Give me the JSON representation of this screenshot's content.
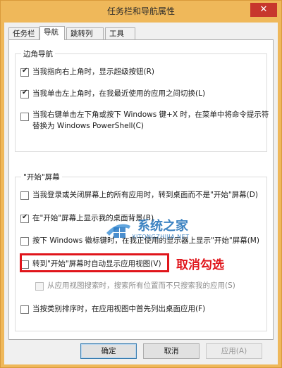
{
  "window": {
    "title": "任务栏和导航属性",
    "close_glyph": "✕"
  },
  "tabs": [
    {
      "label": "任务栏",
      "active": false
    },
    {
      "label": "导航",
      "active": true
    },
    {
      "label": "跳转列表",
      "active": false
    },
    {
      "label": "工具栏",
      "active": false
    }
  ],
  "corner_nav": {
    "heading": "边角导航",
    "options": [
      {
        "label": "当我指向右上角时，显示超级按钮(R)",
        "checked": true
      },
      {
        "label": "当我单击左上角时，在我最近使用的应用之间切换(L)",
        "checked": true
      },
      {
        "label_line1": "当我右键单击左下角或按下 Windows 键+X 时，在菜单中将命令提示符",
        "label_line2": "替换为 Windows PowerShell(C)",
        "checked": false
      }
    ]
  },
  "start_screen": {
    "heading": "\"开始\"屏幕",
    "options": [
      {
        "label": "当我登录或关闭屏幕上的所有应用时，转到桌面而不是\"开始\"屏幕(D)",
        "checked": false
      },
      {
        "label": "在\"开始\"屏幕上显示我的桌面背景(B)",
        "checked": true
      },
      {
        "label": "按下 Windows 徽标键时，在我正使用的显示器上显示\"开始\"屏幕(M)",
        "checked": false
      },
      {
        "label": "转到\"开始\"屏幕时自动显示应用视图(V)",
        "checked": false
      },
      {
        "label": "从应用视图搜索时，搜索所有位置而不只搜索我的应用(S)",
        "checked": false,
        "disabled": true
      },
      {
        "label": "当按类别排序时，在应用视图中首先列出桌面应用(F)",
        "checked": false
      }
    ]
  },
  "annotation": {
    "text": "取消勾选",
    "color": "#e0151b"
  },
  "watermark": {
    "text": "系统之家",
    "sub": "XITONGZHIJIA.NET"
  },
  "buttons": {
    "ok": "确定",
    "cancel": "取消",
    "apply": "应用(A)"
  },
  "colors": {
    "title_bar": "#efb85a",
    "close_button": "#c7372d",
    "highlight": "#e0151b"
  }
}
